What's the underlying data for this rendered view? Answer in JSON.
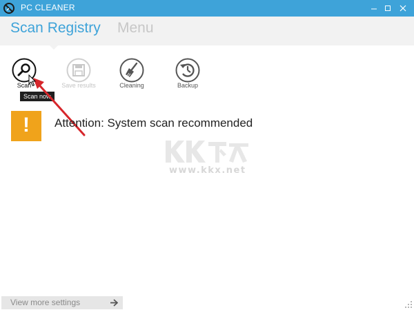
{
  "window": {
    "title": "PC CLEANER",
    "titlebar_color": "#3ea3d9",
    "controls": [
      "minimize-icon",
      "maximize-icon",
      "close-icon"
    ]
  },
  "header": {
    "tabs": [
      {
        "label": "Scan Registry",
        "active": true
      },
      {
        "label": "Menu",
        "active": false
      }
    ],
    "active_color": "#3ea3d9",
    "inactive_color": "#c7c7c7"
  },
  "toolbar": {
    "items": [
      {
        "label": "Scan",
        "icon": "magnifier-icon",
        "enabled": true
      },
      {
        "label": "Save results",
        "icon": "floppy-disk-icon",
        "enabled": false
      },
      {
        "label": "Cleaning",
        "icon": "broom-icon",
        "enabled": true
      },
      {
        "label": "Backup",
        "icon": "restore-clock-icon",
        "enabled": true
      }
    ],
    "tooltip": "Scan now"
  },
  "alert": {
    "icon": "exclamation-icon",
    "symbol": "!",
    "color": "#f0a31b",
    "message": "Attention: System scan recommended"
  },
  "watermark": {
    "url": "www.kkx.net"
  },
  "footer": {
    "more_settings": "View more settings"
  },
  "annotation_color": "#d6262b"
}
